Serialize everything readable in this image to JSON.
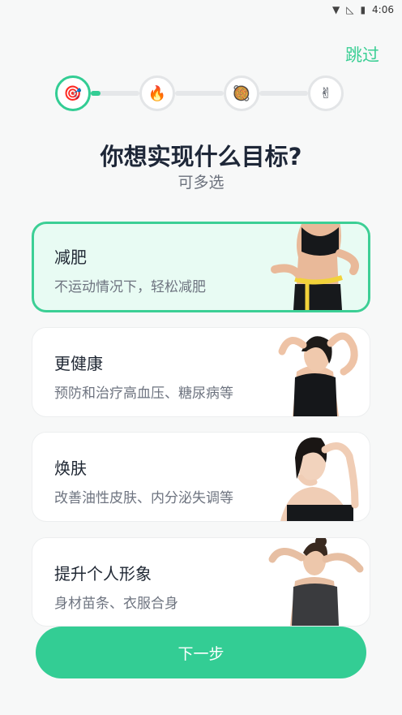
{
  "status_bar": {
    "time": "4:06"
  },
  "header": {
    "skip_label": "跳过"
  },
  "steps": [
    {
      "icon": "target-icon",
      "glyph": "🎯",
      "active": true
    },
    {
      "icon": "fire-icon",
      "glyph": "🔥",
      "active": false
    },
    {
      "icon": "food-pan-icon",
      "glyph": "🥘",
      "active": false
    },
    {
      "icon": "victory-hand-icon",
      "glyph": "✌",
      "active": false
    }
  ],
  "progress": {
    "current_step": 1,
    "total_steps": 4
  },
  "question": {
    "title": "你想实现什么目标?",
    "subtitle": "可多选"
  },
  "goals": [
    {
      "name": "减肥",
      "desc": "不运动情况下，轻松减肥",
      "selected": true
    },
    {
      "name": "更健康",
      "desc": "预防和治疗高血压、糖尿病等",
      "selected": false
    },
    {
      "name": "焕肤",
      "desc": "改善油性皮肤、内分泌失调等",
      "selected": false
    },
    {
      "name": "提升个人形象",
      "desc": "身材苗条、衣服合身",
      "selected": false
    }
  ],
  "footer": {
    "next_label": "下一步"
  },
  "colors": {
    "accent": "#33cd94",
    "selected_bg": "#e8fbf3",
    "title": "#1e2738"
  }
}
